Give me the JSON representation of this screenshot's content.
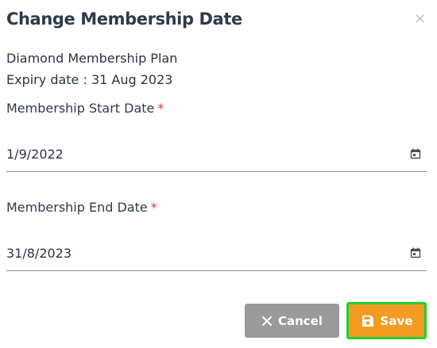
{
  "dialog": {
    "title": "Change Membership Date",
    "close_icon": "close-icon",
    "plan_name": "Diamond Membership Plan",
    "expiry_text": "Expiry date : 31 Aug 2023",
    "start_date": {
      "label": "Membership Start Date",
      "required_mark": "*",
      "value": "1/9/2022",
      "icon": "calendar-icon"
    },
    "end_date": {
      "label": "Membership End Date",
      "required_mark": "*",
      "value": "31/8/2023",
      "icon": "calendar-icon"
    },
    "cancel_button": {
      "label": "Cancel",
      "icon": "x-icon",
      "color": "#9a9a9a"
    },
    "save_button": {
      "label": "Save",
      "icon": "save-icon",
      "color": "#f39c21",
      "highlight": "#22d02a"
    }
  }
}
